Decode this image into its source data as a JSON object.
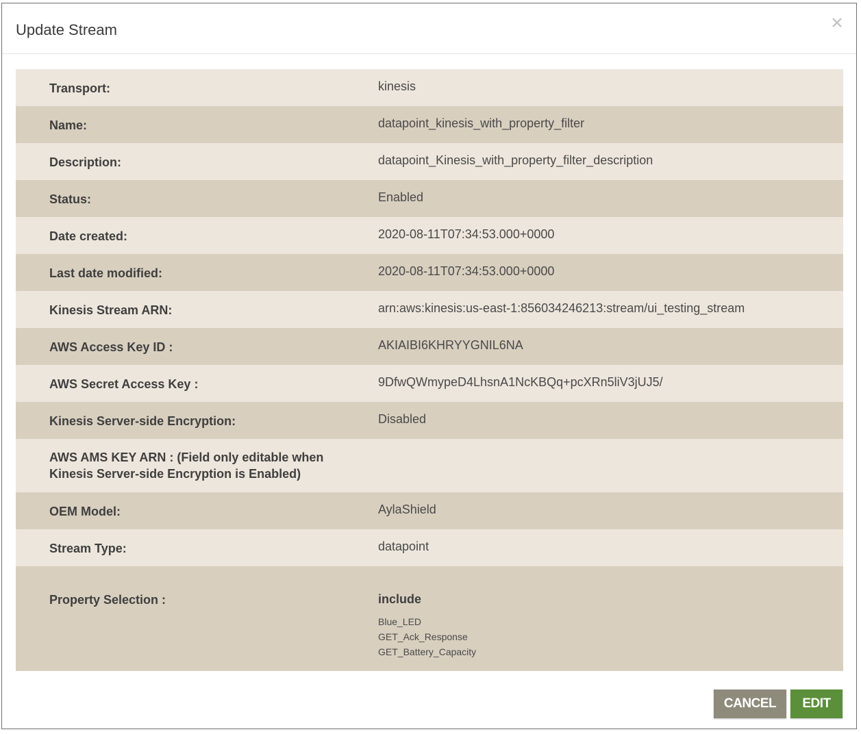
{
  "modal": {
    "title": "Update Stream",
    "close_glyph": "×",
    "close_icon": "close-icon"
  },
  "fields": [
    {
      "label": "Transport:",
      "value": "kinesis"
    },
    {
      "label": "Name:",
      "value": "datapoint_kinesis_with_property_filter"
    },
    {
      "label": "Description:",
      "value": "datapoint_Kinesis_with_property_filter_description"
    },
    {
      "label": "Status:",
      "value": "Enabled"
    },
    {
      "label": "Date created:",
      "value": "2020-08-11T07:34:53.000+0000"
    },
    {
      "label": "Last date modified:",
      "value": "2020-08-11T07:34:53.000+0000"
    },
    {
      "label": "Kinesis Stream ARN:",
      "value": "arn:aws:kinesis:us-east-1:856034246213:stream/ui_testing_stream"
    },
    {
      "label": "AWS Access Key ID :",
      "value": "AKIAIBI6KHRYYGNIL6NA"
    },
    {
      "label": "AWS Secret Access Key :",
      "value": "9DfwQWmypeD4LhsnA1NcKBQq+pcXRn5liV3jUJ5/"
    },
    {
      "label": "Kinesis Server-side Encryption:",
      "value": "Disabled"
    },
    {
      "label_line1": "AWS AMS KEY ARN : (Field only editable when",
      "label_line2": "Kinesis Server-side Encryption is Enabled)",
      "value": ""
    },
    {
      "label": "OEM Model:",
      "value": "AylaShield"
    },
    {
      "label": "Stream Type:",
      "value": "datapoint"
    }
  ],
  "property_selection": {
    "label": "Property Selection :",
    "mode": "include",
    "properties": [
      "Blue_LED",
      "GET_Ack_Response",
      "GET_Battery_Capacity"
    ]
  },
  "buttons": {
    "cancel": "CANCEL",
    "edit": "EDIT"
  },
  "colors": {
    "row_light": "#ede6dc",
    "row_dark": "#d8cfbf",
    "cancel_button": "#8f8b7c",
    "edit_button": "#5b8f3a"
  }
}
